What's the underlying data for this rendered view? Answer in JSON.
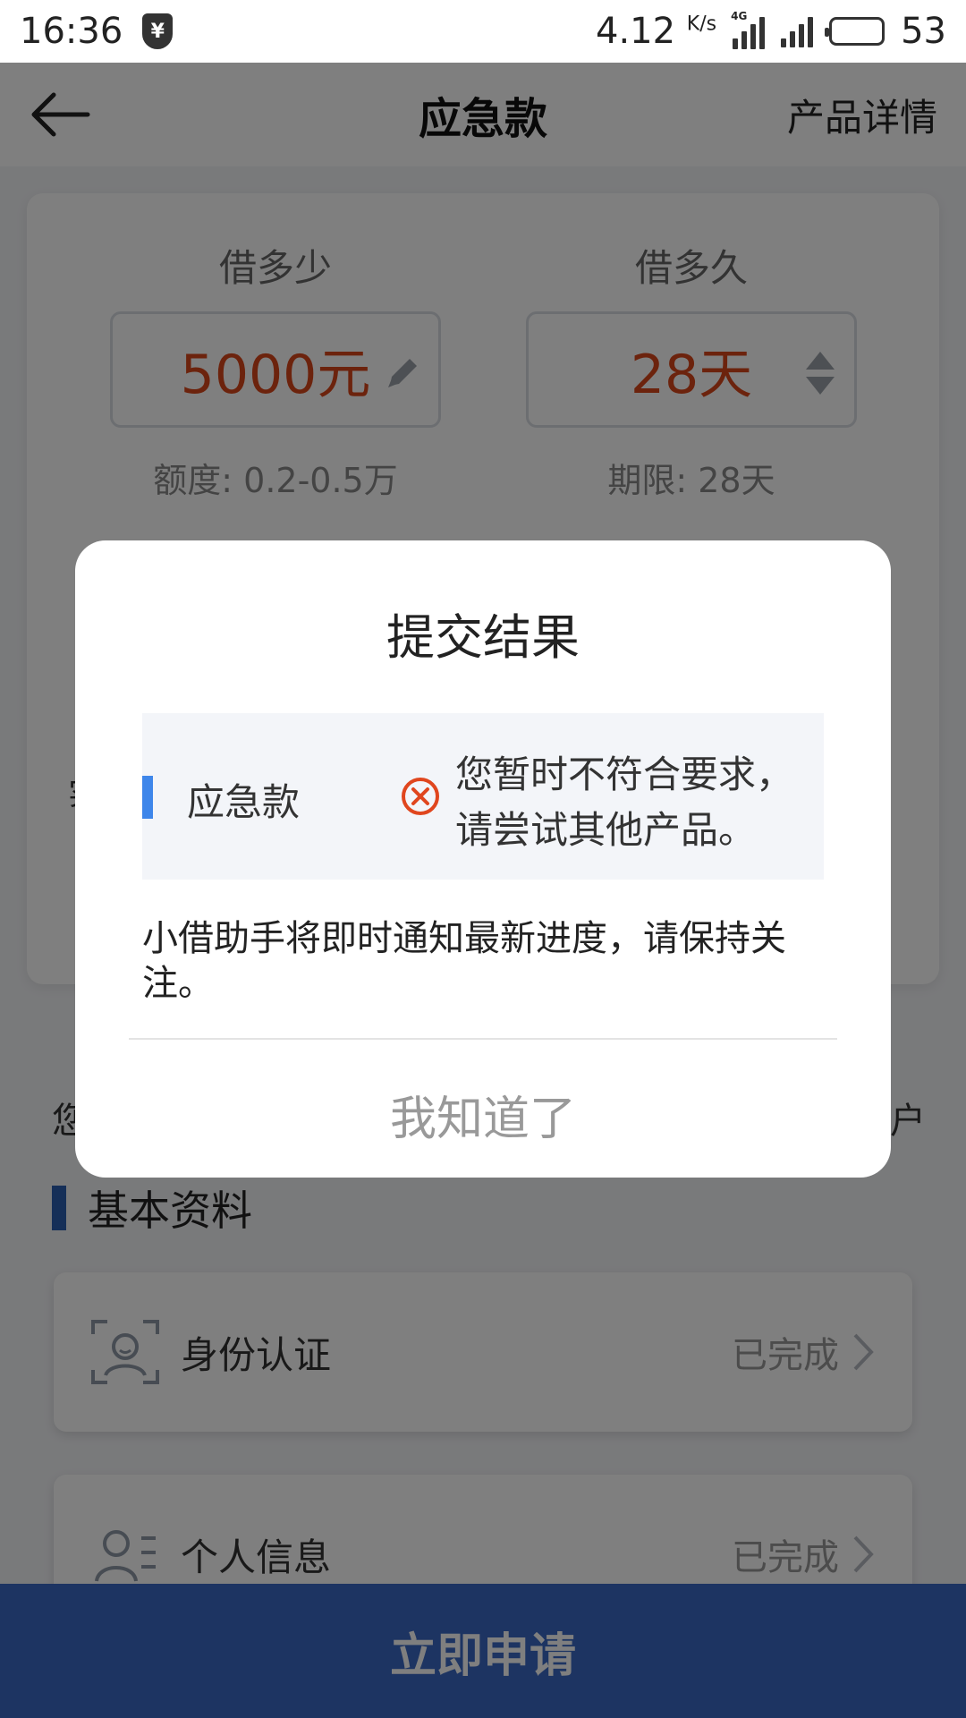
{
  "status_bar": {
    "time": "16:36",
    "shield_glyph": "¥",
    "net_speed": "4.12",
    "net_unit": "K/s",
    "network_type": "4G",
    "battery_level": "53"
  },
  "header": {
    "back_icon": "arrow-left-icon",
    "title": "应急款",
    "link": "产品详情"
  },
  "loan": {
    "amount_label": "借多少",
    "amount_value": "5000元",
    "amount_hint": "额度: 0.2-0.5万",
    "term_label": "借多久",
    "term_value": "28天",
    "term_hint": "期限: 28天",
    "accent_color": "#d9471a"
  },
  "peek": {
    "left_fragment": "您",
    "right_fragment": "户",
    "card_fragment": "实"
  },
  "section": {
    "title": "基本资料",
    "items": [
      {
        "label": "身份认证",
        "status": "已完成",
        "icon": "id-face-icon"
      },
      {
        "label": "个人信息",
        "status": "已完成",
        "icon": "person-list-icon"
      }
    ]
  },
  "apply_button": "立即申请",
  "modal": {
    "title": "提交结果",
    "product": "应急款",
    "result_line1": "您暂时不符合要求，",
    "result_line2": "请尝试其他产品。",
    "note": "小借助手将即时通知最新进度，请保持关注。",
    "ok_button": "我知道了",
    "error_color": "#e0461e"
  }
}
